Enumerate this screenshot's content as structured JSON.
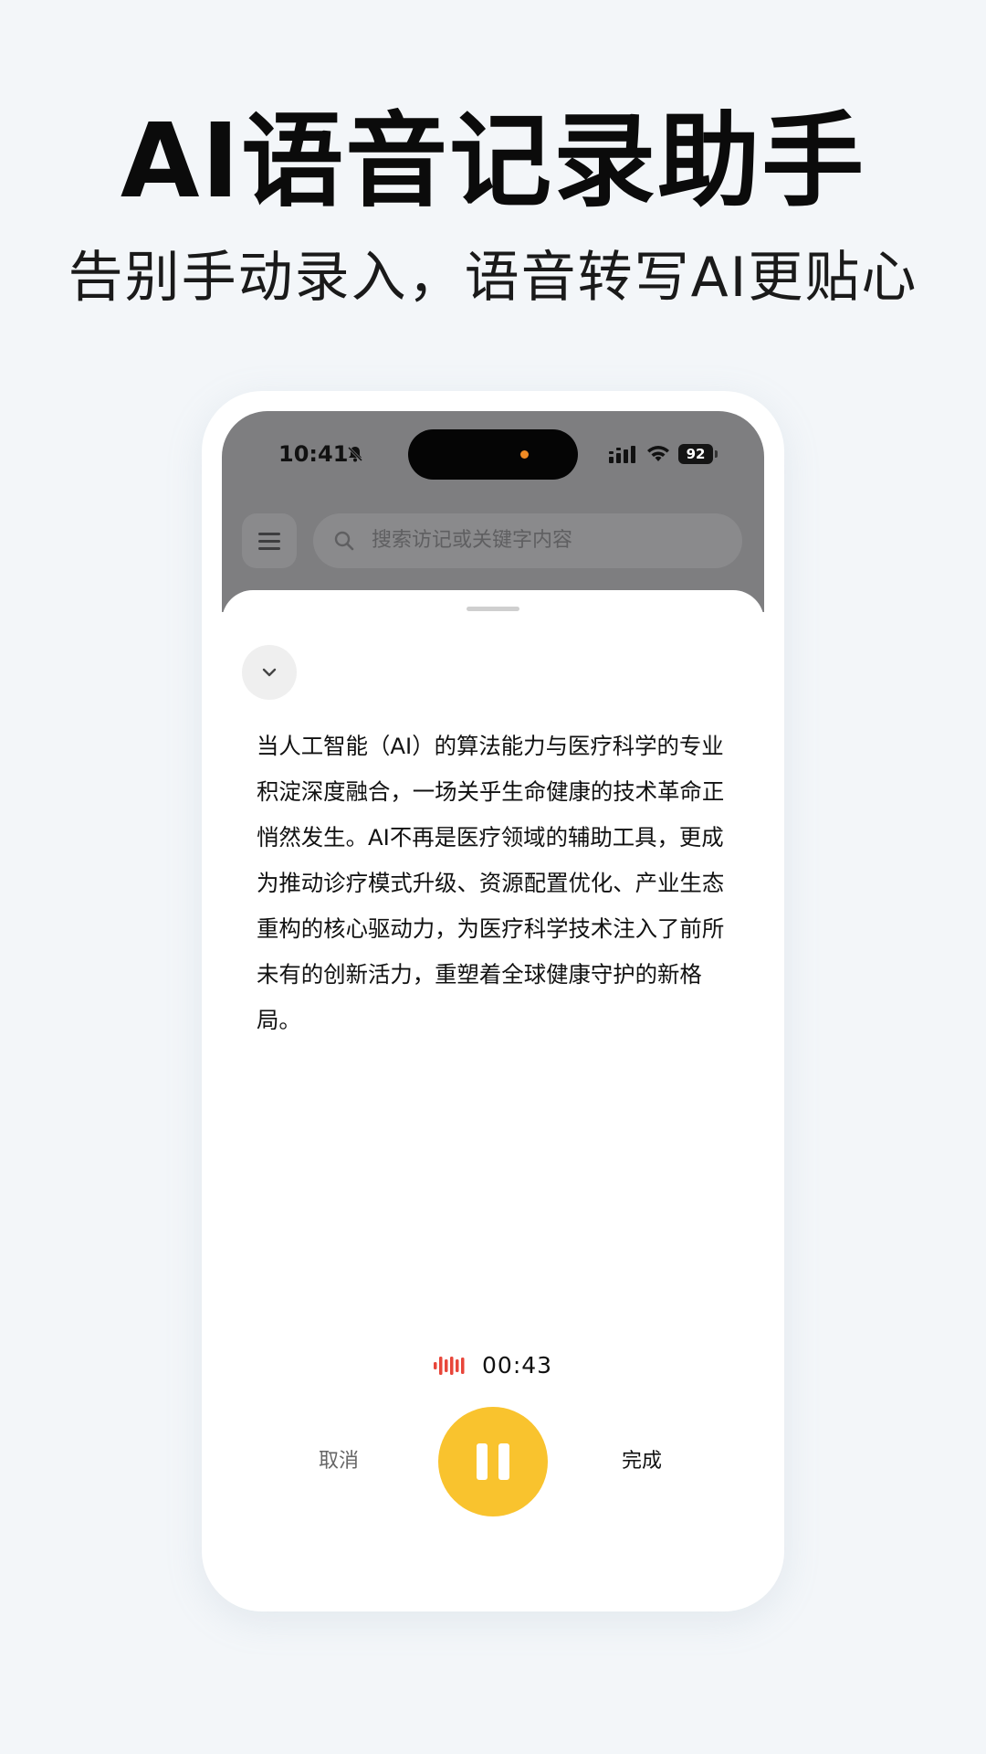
{
  "promo": {
    "headline": "AI语音记录助手",
    "subheadline": "告别手动录入，语音转写AI更贴心"
  },
  "status_bar": {
    "time": "10:41",
    "battery": "92",
    "icons": [
      "bell-off-icon",
      "signal-icon",
      "wifi-icon",
      "battery-icon"
    ]
  },
  "app_header": {
    "search_placeholder": "搜索访记或关键字内容"
  },
  "recording_sheet": {
    "transcript": "当人工智能（AI）的算法能力与医疗科学的专业积淀深度融合，一场关乎生命健康的技术革命正悄然发生。AI不再是医疗领域的辅助工具，更成为推动诊疗模式升级、资源配置优化、产业生态重构的核心驱动力，为医疗科学技术注入了前所未有的创新活力，重塑着全球健康守护的新格局。",
    "timer": "00:43",
    "cancel_label": "取消",
    "done_label": "完成"
  },
  "colors": {
    "accent": "#f9c32e",
    "recording_indicator": "#e8463a",
    "background": "#f3f6f9",
    "overlay": "#7e7e80"
  }
}
